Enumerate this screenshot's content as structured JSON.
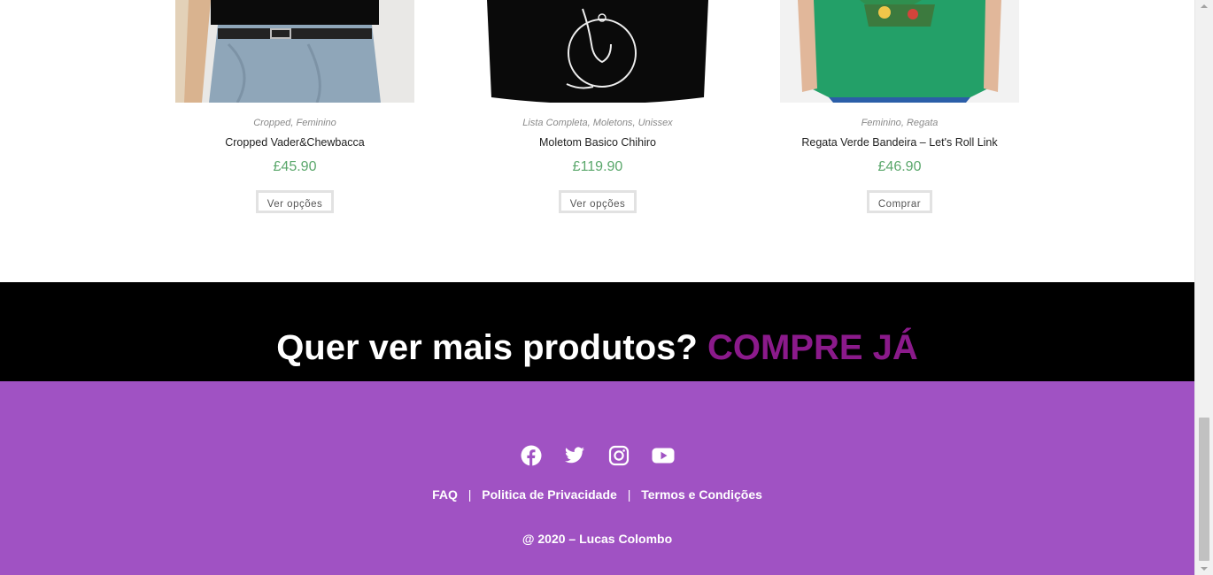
{
  "products": [
    {
      "categories": [
        "Cropped",
        "Feminino"
      ],
      "name": "Cropped Vader&Chewbacca",
      "price": "£45.90",
      "button": "Ver opções"
    },
    {
      "categories": [
        "Lista Completa",
        "Moletons",
        "Unissex"
      ],
      "name": "Moletom Basico Chihiro",
      "price": "£119.90",
      "button": "Ver opções"
    },
    {
      "categories": [
        "Feminino",
        "Regata"
      ],
      "name": "Regata Verde Bandeira – Let's Roll Link",
      "price": "£46.90",
      "button": "Comprar"
    }
  ],
  "cta": {
    "question": "Quer ver mais produtos?",
    "action": "COMPRE JÁ"
  },
  "footer": {
    "socials": [
      "facebook-icon",
      "twitter-icon",
      "instagram-icon",
      "youtube-icon"
    ],
    "links": [
      "FAQ",
      "Politica de Privacidade",
      "Termos e Condições"
    ],
    "link_separator": "|",
    "copyright": "@ 2020 – Lucas Colombo"
  },
  "colors": {
    "price": "#5aa76b",
    "cta_background": "#000000",
    "cta_accent": "#8b1a8b",
    "footer_background": "#a052c3"
  }
}
